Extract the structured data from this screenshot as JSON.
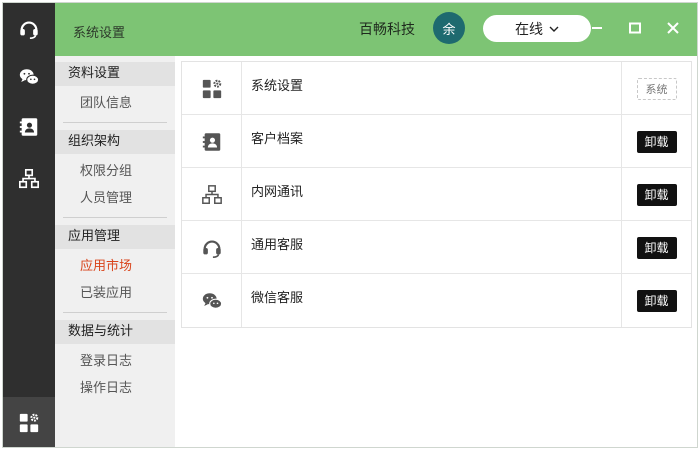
{
  "window": {
    "title": "系统设置",
    "company": "百畅科技",
    "avatar_text": "余",
    "status_label": "在线"
  },
  "rail": {
    "items": [
      {
        "icon": "headset-icon"
      },
      {
        "icon": "wechat-icon"
      },
      {
        "icon": "contact-card-icon"
      },
      {
        "icon": "org-chart-icon"
      }
    ],
    "bottom_icon": "apps-settings-icon"
  },
  "menu": {
    "groups": [
      {
        "label": "资料设置",
        "items": [
          "团队信息"
        ]
      },
      {
        "label": "组织架构",
        "items": [
          "权限分组",
          "人员管理"
        ]
      },
      {
        "label": "应用管理",
        "items": [
          "应用市场",
          "已装应用"
        ]
      },
      {
        "label": "数据与统计",
        "items": [
          "登录日志",
          "操作日志"
        ]
      }
    ],
    "active_item": "应用市场"
  },
  "apps": [
    {
      "name": "系统设置",
      "icon": "apps-settings-icon",
      "action": "系统",
      "action_type": "tag"
    },
    {
      "name": "客户档案",
      "icon": "contact-card-icon",
      "action": "卸载",
      "action_type": "button"
    },
    {
      "name": "内网通讯",
      "icon": "org-chart-icon",
      "action": "卸载",
      "action_type": "button"
    },
    {
      "name": "通用客服",
      "icon": "headset-icon",
      "action": "卸载",
      "action_type": "button"
    },
    {
      "name": "微信客服",
      "icon": "wechat-icon",
      "action": "卸载",
      "action_type": "button"
    }
  ],
  "colors": {
    "titlebar": "#7dc474",
    "rail": "#2f2f2f",
    "avatar": "#1e6a6f",
    "active_menu": "#d9441b",
    "button": "#111111"
  }
}
